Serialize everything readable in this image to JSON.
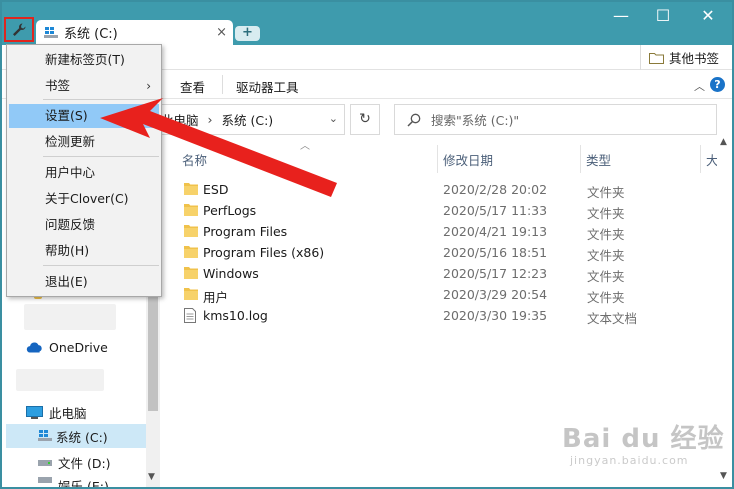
{
  "tab": {
    "label": "系统 (C:)",
    "close": "×",
    "new_tab": "+"
  },
  "window_controls": {
    "minimize": "—",
    "maximize": "☐",
    "close": "✕"
  },
  "bookmarks": {
    "other": "其他书签"
  },
  "ribbon": {
    "tabs": [
      "查看",
      "驱动器工具"
    ],
    "collapse": "︿",
    "help": "?"
  },
  "address": {
    "segments": [
      "此电脑",
      "系统 (C:)"
    ],
    "separator": "›",
    "dropdown": "⌄",
    "refresh": "↻"
  },
  "search": {
    "placeholder": "搜索\"系统 (C:)\""
  },
  "columns": {
    "name": "名称",
    "modified": "修改日期",
    "type": "类型",
    "size": "大小"
  },
  "files": [
    {
      "name": "ESD",
      "date": "2020/2/28 20:02",
      "type": "文件夹",
      "icon": "folder-icon"
    },
    {
      "name": "PerfLogs",
      "date": "2020/5/17 11:33",
      "type": "文件夹",
      "icon": "folder-icon"
    },
    {
      "name": "Program Files",
      "date": "2020/4/21 19:13",
      "type": "文件夹",
      "icon": "folder-icon"
    },
    {
      "name": "Program Files (x86)",
      "date": "2020/5/16 18:51",
      "type": "文件夹",
      "icon": "folder-icon"
    },
    {
      "name": "Windows",
      "date": "2020/5/17 12:23",
      "type": "文件夹",
      "icon": "folder-icon"
    },
    {
      "name": "用户",
      "date": "2020/3/29 20:54",
      "type": "文件夹",
      "icon": "folder-icon"
    },
    {
      "name": "kms10.log",
      "date": "2020/3/30 19:35",
      "type": "文本文档",
      "icon": "text-file-icon"
    }
  ],
  "sidebar": {
    "onedrive": "OneDrive",
    "this_pc": "此电脑",
    "drives": [
      "系统 (C:)",
      "文件 (D:)",
      "娱乐 (E:)"
    ]
  },
  "menu": {
    "items": [
      {
        "label": "新建标签页(T)"
      },
      {
        "label": "书签",
        "submenu": "›"
      },
      {
        "label": "设置(S)"
      },
      {
        "label": "检测更新"
      },
      {
        "label": "用户中心"
      },
      {
        "label": "关于Clover(C)"
      },
      {
        "label": "问题反馈"
      },
      {
        "label": "帮助(H)"
      },
      {
        "label": "退出(E)"
      }
    ]
  },
  "watermark": {
    "logo": "Bai du 经验",
    "url": "jingyan.baidu.com"
  },
  "colors": {
    "titlebar": "#3e9bad",
    "highlight": "#91c9f7",
    "selected": "#cde8f7",
    "arrow": "#e8211d",
    "folder": "#f0c24b"
  }
}
